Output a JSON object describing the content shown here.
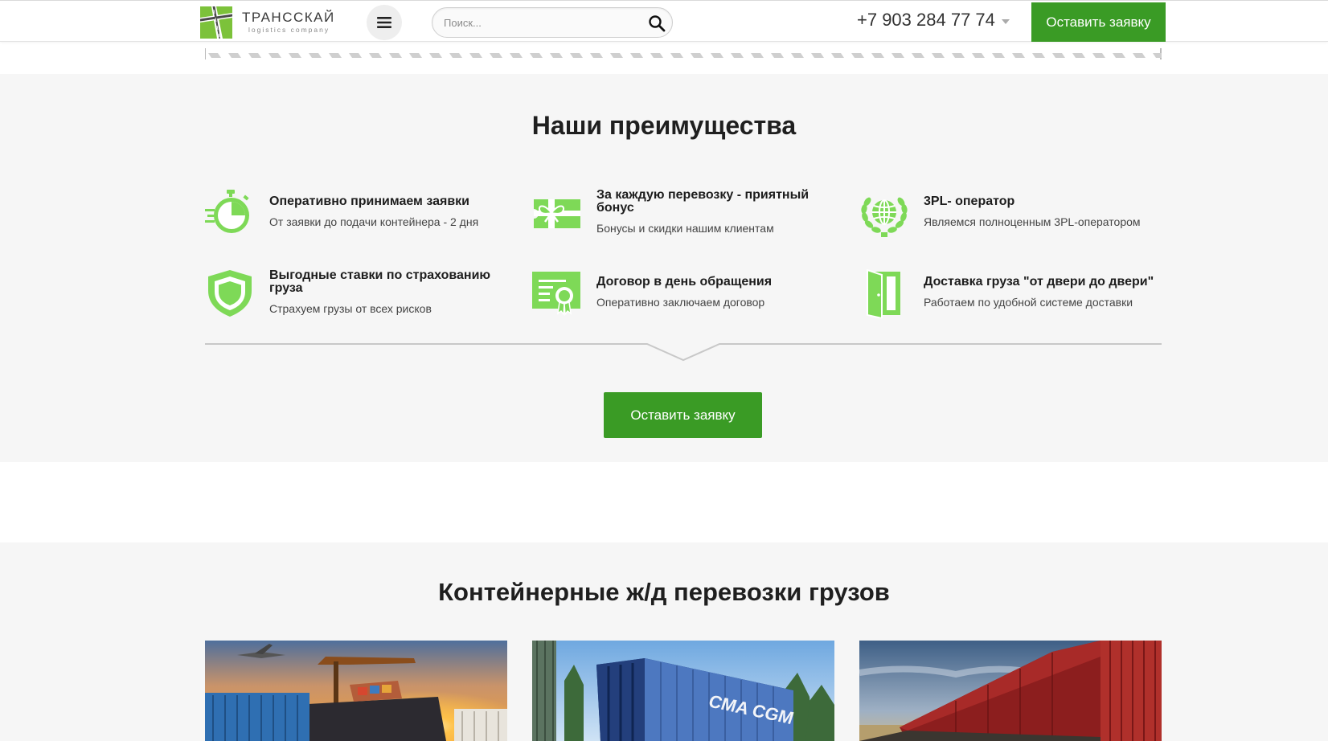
{
  "header": {
    "logo_name": "ТРАНССКАЙ",
    "logo_sub": "logistics company",
    "search_placeholder": "Поиск...",
    "phone": "+7 903 284 77 74",
    "cta": "Оставить заявку"
  },
  "advantages": {
    "title": "Наши преимущества",
    "items": [
      {
        "head": "Оперативно принимаем заявки",
        "desc": "От заявки до подачи контейнера  - 2 дня",
        "icon": "stopwatch-icon"
      },
      {
        "head": "За каждую перевозку - приятный бонус",
        "desc": "Бонусы и скидки нашим клиентам",
        "icon": "gift-voucher-icon"
      },
      {
        "head": "3PL- оператор",
        "desc": "Являемся полноценным 3PL-оператором",
        "icon": "globe-laurel-icon"
      },
      {
        "head": "Выгодные ставки по страхованию груза",
        "desc": "Страхуем грузы от всех рисков",
        "icon": "shield-icon"
      },
      {
        "head": "Договор в день обращения",
        "desc": "Оперативно заключаем договор",
        "icon": "certificate-icon"
      },
      {
        "head": "Доставка груза \"от двери до двери\"",
        "desc": "Работаем по удобной системе доставки",
        "icon": "door-icon"
      }
    ],
    "cta": "Оставить заявку"
  },
  "containers": {
    "title": "Контейнерные ж/д перевозки грузов",
    "cards": [
      {
        "image": "port-ship-airplane-sunset"
      },
      {
        "image": "blue-cma-cgm-container-train",
        "container_text": "CMA CGM"
      },
      {
        "image": "red-container-train-steppe"
      }
    ]
  },
  "colors": {
    "accent_green": "#3a9b25",
    "icon_green": "#7ed957",
    "section_bg": "#f6f6f6"
  }
}
